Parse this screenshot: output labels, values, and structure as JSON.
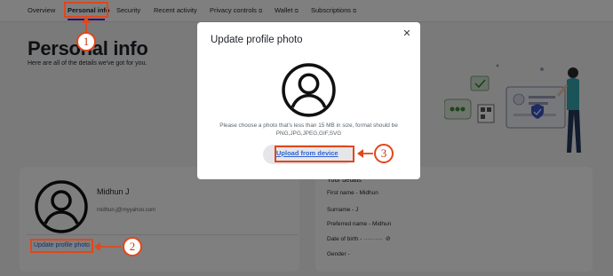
{
  "nav": {
    "items": [
      {
        "label": "Overview",
        "external": false
      },
      {
        "label": "Personal info",
        "external": false,
        "active": true
      },
      {
        "label": "Security",
        "external": false
      },
      {
        "label": "Recent activity",
        "external": false
      },
      {
        "label": "Privacy controls",
        "external": true
      },
      {
        "label": "Wallet",
        "external": true
      },
      {
        "label": "Subscriptions",
        "external": true
      }
    ],
    "external_glyph": "⧉",
    "active_color": "#6001d2"
  },
  "page": {
    "title": "Personal info",
    "subtitle": "Here are all of the details we've got for you."
  },
  "profile": {
    "name": "Midhun J",
    "email": "midhun.j@myyahoo.com",
    "update_link": "Update profile photo"
  },
  "details": {
    "title": "Your details",
    "rows": [
      {
        "label": "First name",
        "value": "Midhun"
      },
      {
        "label": "Surname",
        "value": "J"
      },
      {
        "label": "Preferred name",
        "value": "Midhun"
      },
      {
        "label": "Date of birth",
        "value": "··········"
      },
      {
        "label": "Gender",
        "value": ""
      }
    ]
  },
  "modal": {
    "title": "Update profile photo",
    "close_icon": "close-icon",
    "description": "Please choose a photo that's less than 15 MB in size, format should be PNG,JPG,JPEG,GIF,SVG",
    "upload_button": "Upload from device"
  },
  "annotations": {
    "steps": [
      "1",
      "2",
      "3"
    ],
    "color": "#e0471b"
  },
  "colors": {
    "link": "#0f69ff",
    "upload_link": "#2d64d6",
    "overlay": "rgba(0,0,0,0.5)"
  }
}
